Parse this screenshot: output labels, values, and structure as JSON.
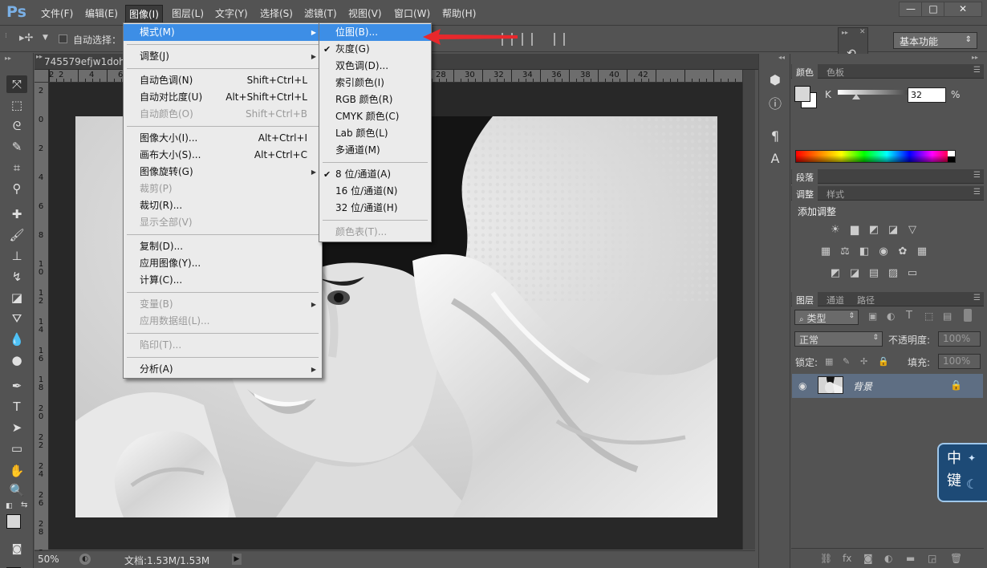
{
  "app": {
    "logo": "Ps"
  },
  "menubar": {
    "items": [
      "文件(F)",
      "编辑(E)",
      "图像(I)",
      "图层(L)",
      "文字(Y)",
      "选择(S)",
      "滤镜(T)",
      "视图(V)",
      "窗口(W)",
      "帮助(H)"
    ],
    "active_index": 2
  },
  "window_controls": {
    "minimize": "—",
    "maximize": "□",
    "close": "✕"
  },
  "options_bar": {
    "auto_select_label": "自动选择：",
    "workspace": "基本功能"
  },
  "document": {
    "tab_title": "745579efjw1dohh",
    "ruler_top": [
      "2",
      "0",
      "2",
      "4",
      "6",
      "8",
      "10",
      "12",
      "14",
      "16",
      "18",
      "20",
      "22",
      "24",
      "26",
      "28",
      "30",
      "32",
      "34",
      "36",
      "38",
      "40",
      "42"
    ],
    "ruler_left": [
      "2",
      "0",
      "2",
      "4",
      "6",
      "8",
      "10",
      "12",
      "14",
      "16",
      "18",
      "20",
      "22",
      "24",
      "26",
      "28",
      "30"
    ]
  },
  "status": {
    "zoom": "50%",
    "doc_size": "文档:1.53M/1.53M"
  },
  "image_menu": {
    "items": [
      {
        "label": "模式(M)",
        "submenu": true,
        "highlighted": true
      },
      {
        "separator": true
      },
      {
        "label": "调整(J)",
        "submenu": true
      },
      {
        "separator": true
      },
      {
        "label": "自动色调(N)",
        "shortcut": "Shift+Ctrl+L"
      },
      {
        "label": "自动对比度(U)",
        "shortcut": "Alt+Shift+Ctrl+L"
      },
      {
        "label": "自动颜色(O)",
        "shortcut": "Shift+Ctrl+B",
        "disabled": true
      },
      {
        "separator": true
      },
      {
        "label": "图像大小(I)...",
        "shortcut": "Alt+Ctrl+I"
      },
      {
        "label": "画布大小(S)...",
        "shortcut": "Alt+Ctrl+C"
      },
      {
        "label": "图像旋转(G)",
        "submenu": true
      },
      {
        "label": "裁剪(P)",
        "disabled": true
      },
      {
        "label": "裁切(R)..."
      },
      {
        "label": "显示全部(V)",
        "disabled": true
      },
      {
        "separator": true
      },
      {
        "label": "复制(D)..."
      },
      {
        "label": "应用图像(Y)..."
      },
      {
        "label": "计算(C)..."
      },
      {
        "separator": true
      },
      {
        "label": "变量(B)",
        "submenu": true,
        "disabled": true
      },
      {
        "label": "应用数据组(L)...",
        "disabled": true
      },
      {
        "separator": true
      },
      {
        "label": "陷印(T)...",
        "disabled": true
      },
      {
        "separator": true
      },
      {
        "label": "分析(A)",
        "submenu": true
      }
    ]
  },
  "mode_submenu": {
    "items": [
      {
        "label": "位图(B)...",
        "highlighted": true
      },
      {
        "label": "灰度(G)",
        "checked": true
      },
      {
        "label": "双色调(D)..."
      },
      {
        "label": "索引颜色(I)"
      },
      {
        "label": "RGB 颜色(R)"
      },
      {
        "label": "CMYK 颜色(C)"
      },
      {
        "label": "Lab 颜色(L)"
      },
      {
        "label": "多通道(M)"
      },
      {
        "separator": true
      },
      {
        "label": "8 位/通道(A)",
        "checked": true
      },
      {
        "label": "16 位/通道(N)"
      },
      {
        "label": "32 位/通道(H)"
      },
      {
        "separator": true
      },
      {
        "label": "颜色表(T)...",
        "disabled": true
      }
    ]
  },
  "color_panel": {
    "tabs": [
      "颜色",
      "色板"
    ],
    "channel": "K",
    "value": "32",
    "unit": "%",
    "k_level_percent": 32
  },
  "paragraph_panel": {
    "tabs": [
      "段落"
    ]
  },
  "adjust_panel": {
    "tabs": [
      "调整",
      "样式"
    ],
    "title": "添加调整"
  },
  "layers_panel": {
    "tabs": [
      "图层",
      "通道",
      "路径"
    ],
    "filter_kind": "类型",
    "blend_mode": "正常",
    "opacity_label": "不透明度:",
    "opacity_value": "100%",
    "lock_label": "锁定:",
    "fill_label": "填充:",
    "fill_value": "100%",
    "layers": [
      {
        "name": "背景"
      }
    ]
  },
  "badge": {
    "text": "中键"
  },
  "colors": {
    "highlight": "#3d8ee6",
    "annotation_arrow": "#e8282c",
    "layer_selected": "#5e6e83"
  }
}
